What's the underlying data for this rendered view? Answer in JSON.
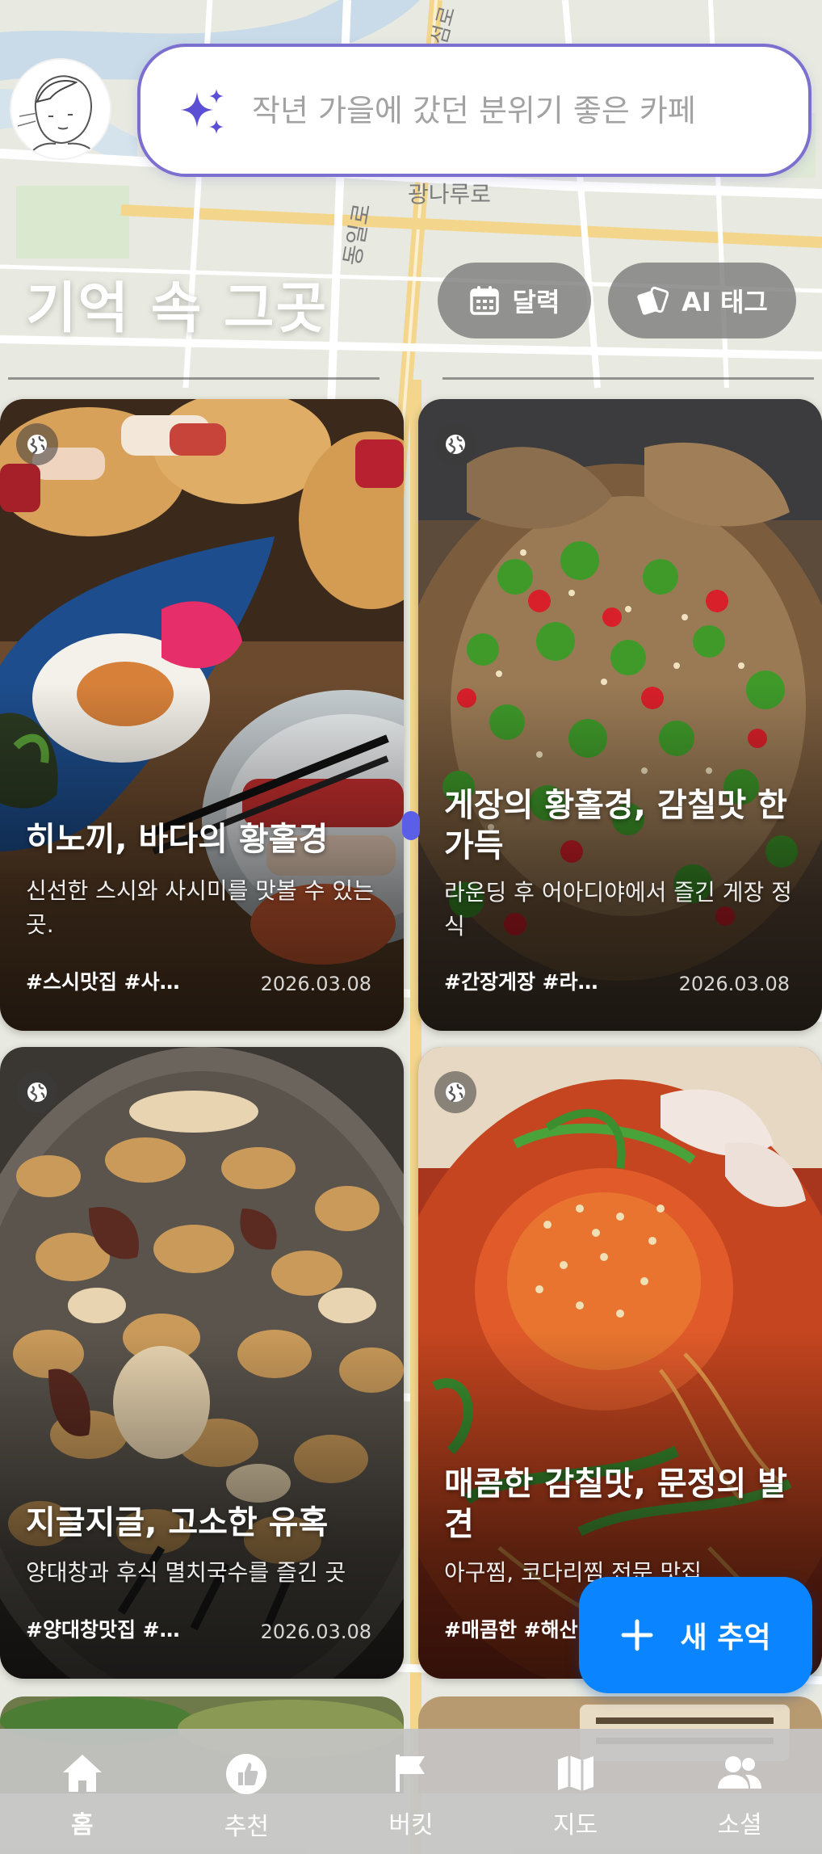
{
  "search": {
    "placeholder": "작년 가을에 갔던 분위기 좋은 카페"
  },
  "map_labels": [
    "광나루로",
    "동일로",
    "뚝섬로"
  ],
  "header": {
    "title": "기억 속 그곳",
    "calendar_label": "달력",
    "ai_tag_label": "AI 태그"
  },
  "cards": [
    {
      "title": "히노끼, 바다의 황홀경",
      "description": "신선한 스시와 사시미를 맛볼 수 있는 곳.",
      "tags": "#스시맛집 #사…",
      "date": "2026.03.08"
    },
    {
      "title": "게장의 황홀경, 감칠맛 한가득",
      "description": "라운딩 후 어아디야에서 즐긴 게장 정식",
      "tags": "#간장게장 #라…",
      "date": "2026.03.08"
    },
    {
      "title": "지글지글, 고소한 유혹",
      "description": "양대창과 후식 멸치국수를 즐긴 곳",
      "tags": "#양대창맛집 #…",
      "date": "2026.03.08"
    },
    {
      "title": "매콤한 감칠맛, 문정의 발견",
      "description": "아구찜, 코다리찜 전문 맛집",
      "tags": "#매콤한 #해산",
      "date": ""
    }
  ],
  "fab": {
    "label": "새 추억"
  },
  "nav": [
    {
      "label": "홈",
      "icon": "home-icon",
      "active": true
    },
    {
      "label": "추천",
      "icon": "thumb-up-icon",
      "active": false
    },
    {
      "label": "버킷",
      "icon": "flag-icon",
      "active": false
    },
    {
      "label": "지도",
      "icon": "map-icon",
      "active": false
    },
    {
      "label": "소셜",
      "icon": "people-icon",
      "active": false
    }
  ],
  "colors": {
    "accent": "#0a84ff",
    "search_border": "#7b6fd0",
    "sparkle": "#5b4fd6"
  }
}
